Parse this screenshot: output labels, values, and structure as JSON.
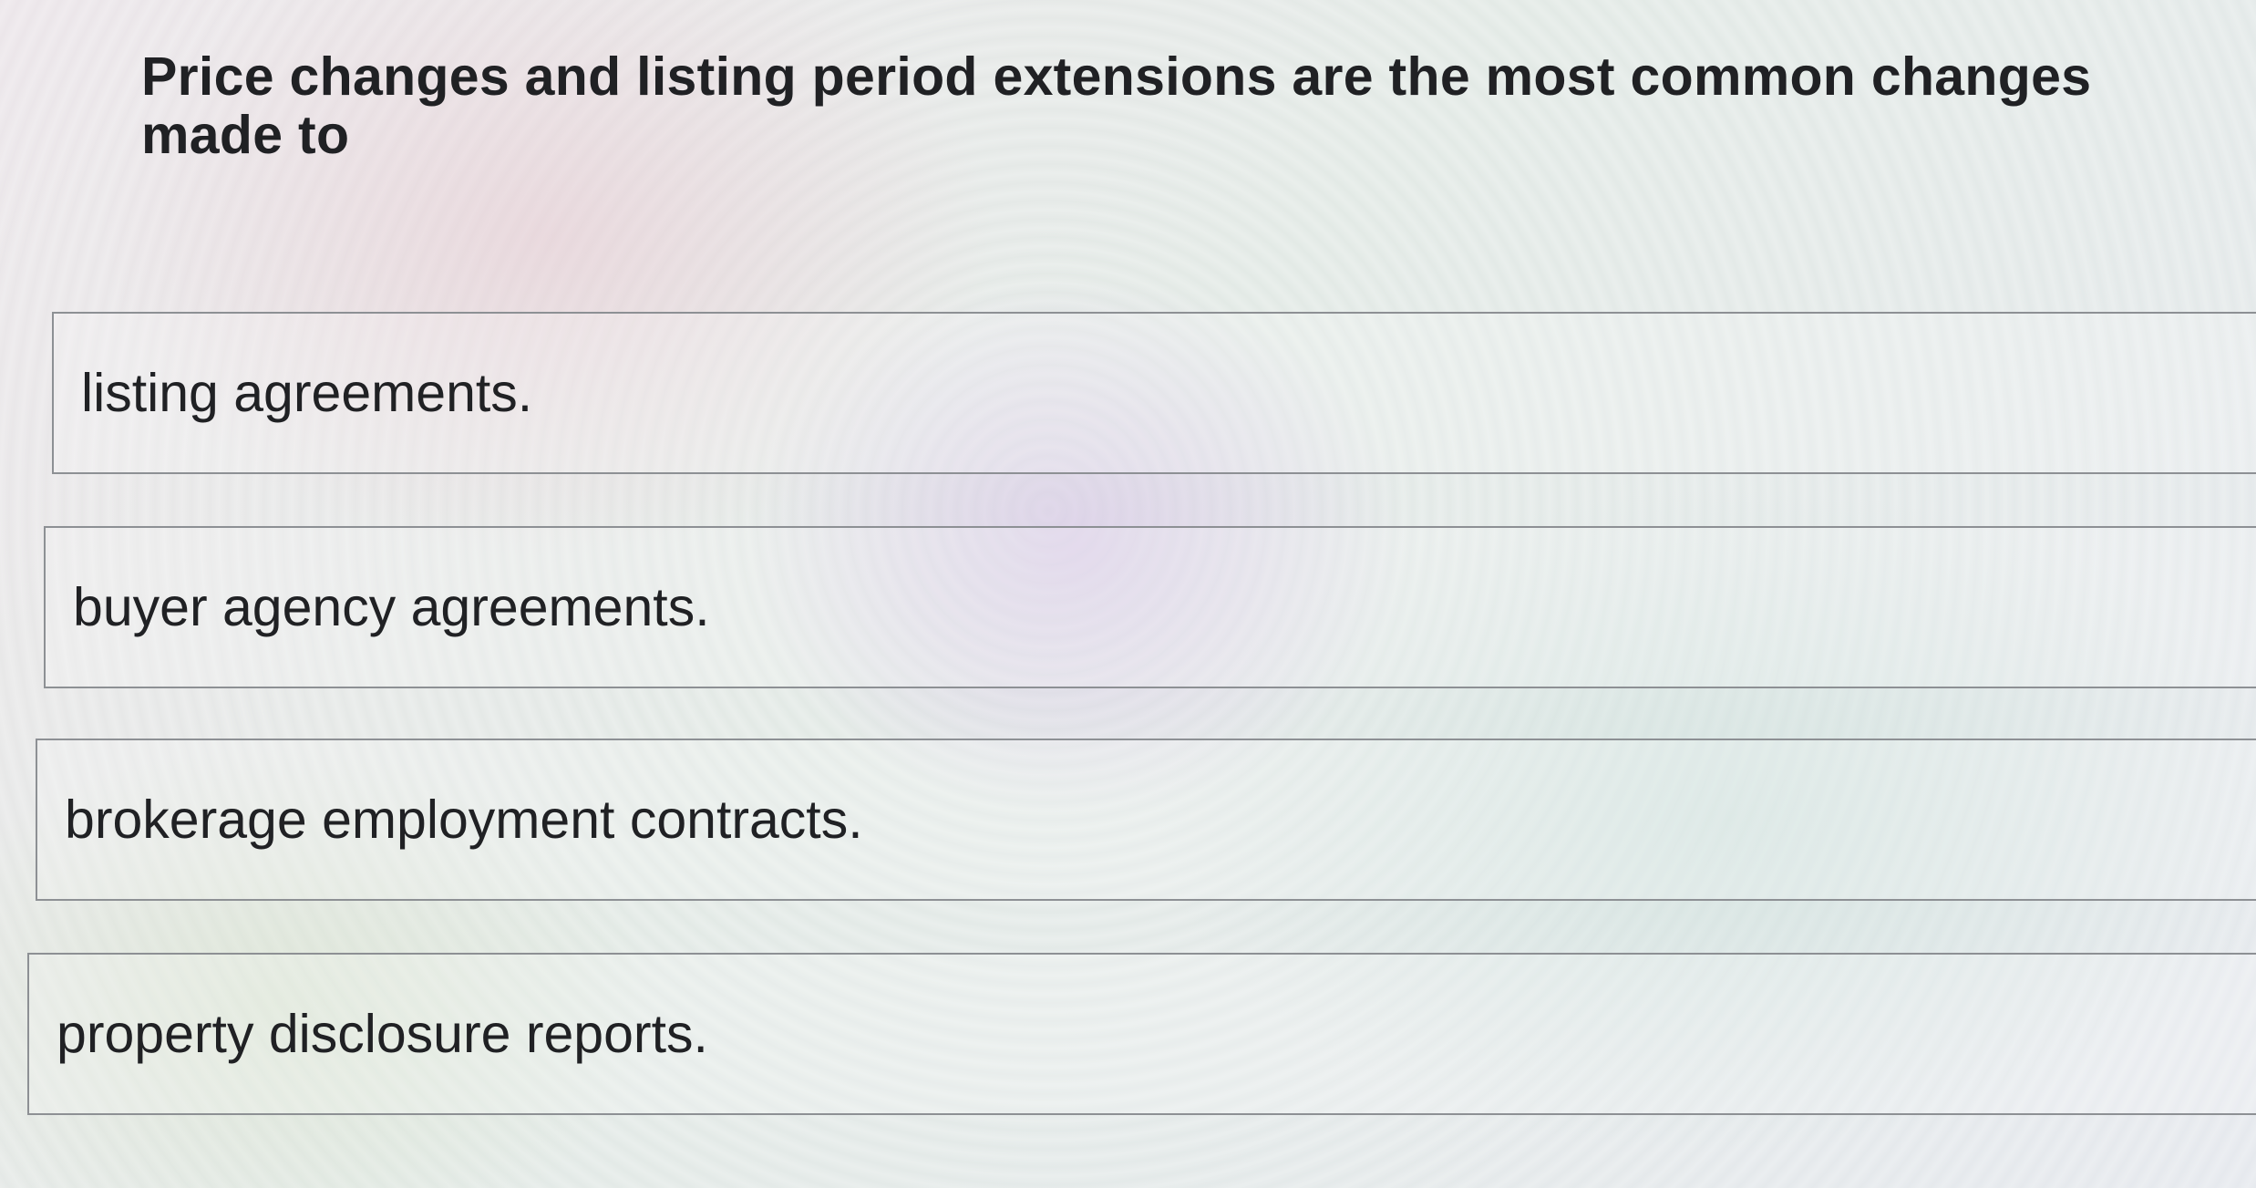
{
  "question": {
    "text": "Price changes and listing period extensions are the most common changes made to"
  },
  "options": [
    {
      "label": "listing agreements."
    },
    {
      "label": "buyer agency agreements."
    },
    {
      "label": "brokerage employment contracts."
    },
    {
      "label": "property disclosure reports."
    }
  ]
}
